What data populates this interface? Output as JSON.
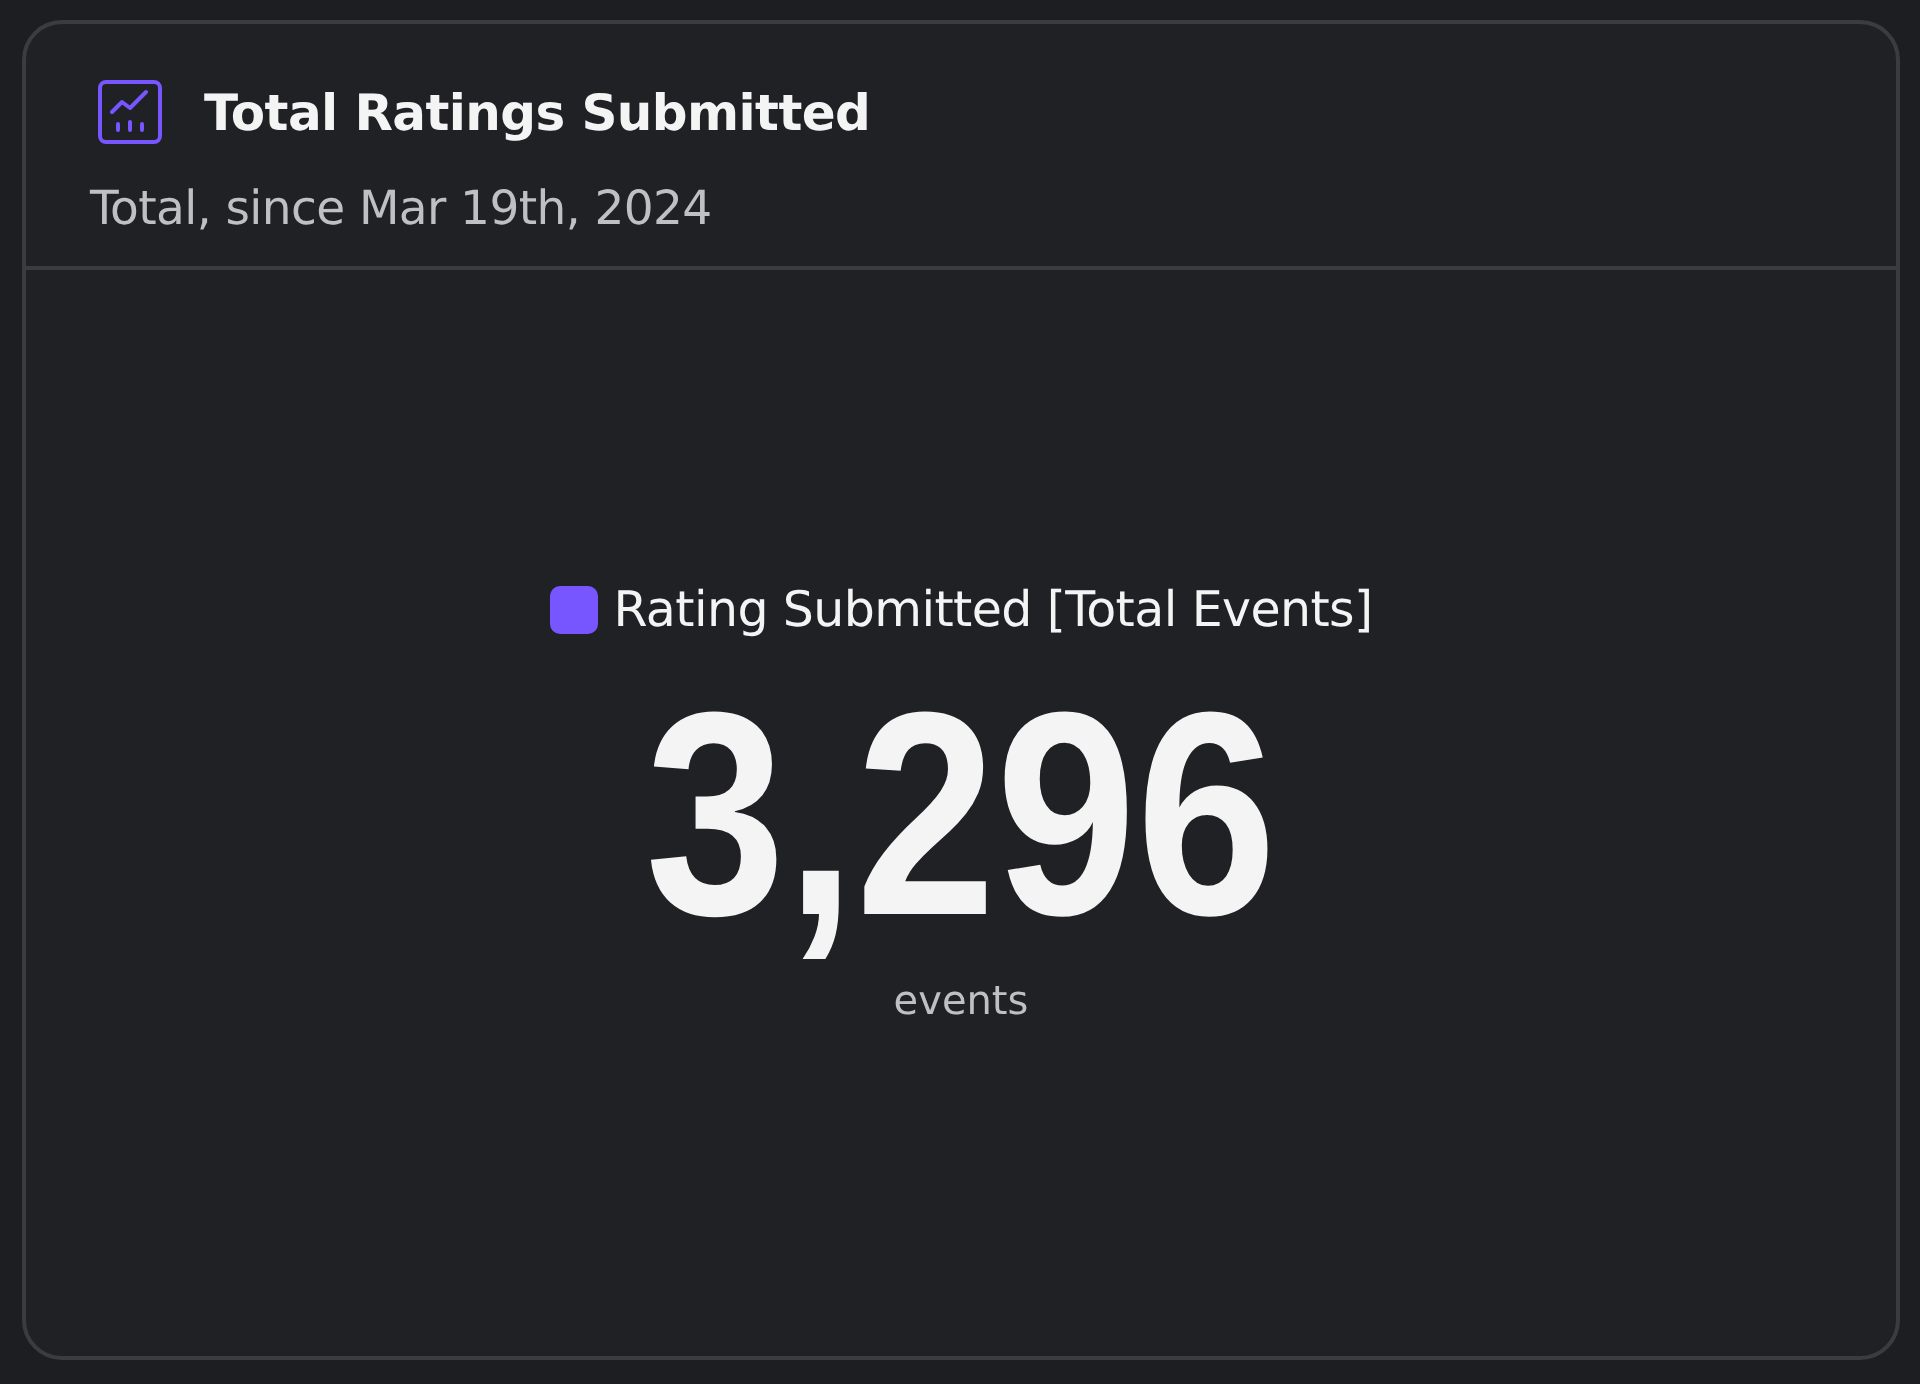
{
  "card": {
    "title": "Total Ratings Submitted",
    "subtitle": "Total, since Mar 19th, 2024"
  },
  "metric": {
    "series": "Rating Submitted [Total Events]",
    "color": "#7856ff",
    "value": "3,296",
    "unit": "events"
  }
}
